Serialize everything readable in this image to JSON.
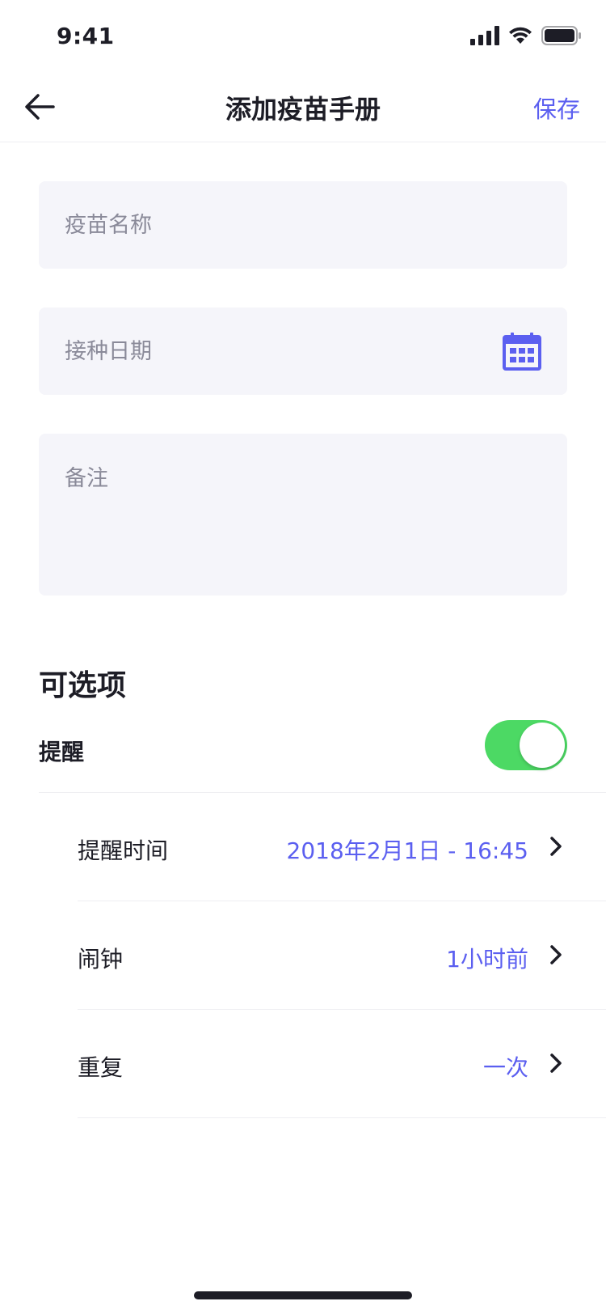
{
  "status_bar": {
    "time": "9:41"
  },
  "nav": {
    "title": "添加疫苗手册",
    "save_label": "保存",
    "back_icon": "arrow-left-icon"
  },
  "form": {
    "name_placeholder": "疫苗名称",
    "date_placeholder": "接种日期",
    "note_placeholder": "备注",
    "calendar_icon": "calendar-icon"
  },
  "options": {
    "title": "可选项",
    "remind_label": "提醒",
    "remind_enabled": true,
    "rows": [
      {
        "label": "提醒时间",
        "value": "2018年2月1日 - 16:45"
      },
      {
        "label": "闹钟",
        "value": "1小时前"
      },
      {
        "label": "重复",
        "value": "一次"
      }
    ]
  },
  "colors": {
    "accent": "#5b5ff0",
    "toggle_on": "#4cd964",
    "field_bg": "#f5f5fa",
    "text": "#1d1d26"
  }
}
